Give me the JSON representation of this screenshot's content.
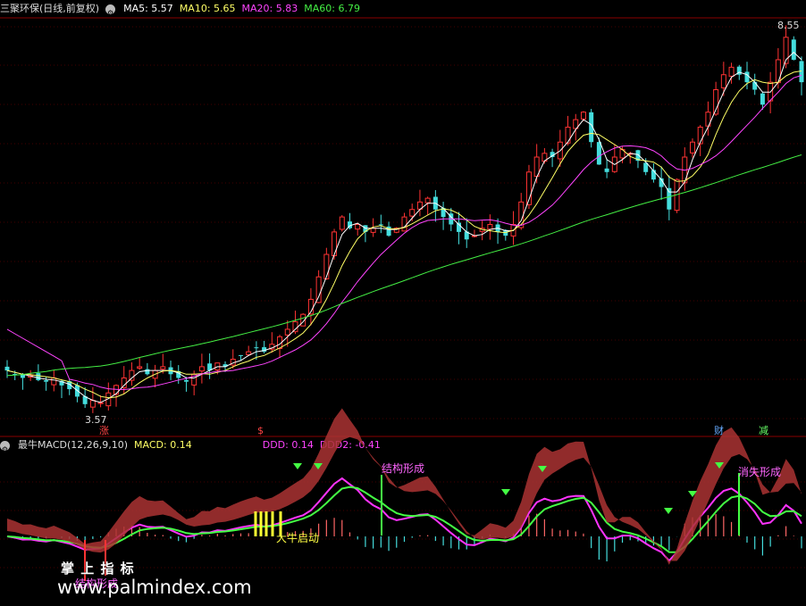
{
  "top": {
    "title": "三聚环保(日线,前复权)",
    "ma": [
      {
        "label": "MA5: 5.57",
        "color": "#ffffff"
      },
      {
        "label": "MA10: 5.65",
        "color": "#ffff66"
      },
      {
        "label": "MA20: 5.83",
        "color": "#ff44ff"
      },
      {
        "label": "MA60: 6.79",
        "color": "#44ee44"
      }
    ],
    "high_label": "8.55",
    "low_label": "3.57",
    "markers": [
      {
        "text": "涨",
        "color": "#ff4444"
      },
      {
        "text": "$",
        "color": "#ff4444"
      },
      {
        "text": "财",
        "color": "#66aaff"
      },
      {
        "text": "减",
        "color": "#66ff66"
      }
    ]
  },
  "bottom": {
    "title": "最牛MACD(12,26,9,10)",
    "indicators": [
      {
        "label": "MACD: 0.14",
        "color": "#ffff66"
      },
      {
        "label": "DDD: 0.14",
        "color": "#ff44ff"
      },
      {
        "label": "DDD2: -0.41",
        "color": "#ff44ff"
      }
    ],
    "annotations": [
      {
        "text": "结构形成",
        "color": "#ff66ff"
      },
      {
        "text": "消失形成",
        "color": "#ff66ff"
      },
      {
        "text": "大牛启动",
        "color": "#ffff44"
      },
      {
        "text": "结构形成",
        "color": "#ff66ff"
      }
    ]
  },
  "watermark": {
    "cn": "掌 上 指 标",
    "url": "www.palmindex.com"
  },
  "colors": {
    "up": "#ff3333",
    "down": "#44dddd",
    "ma5": "#ffffff",
    "ma10": "#ffff66",
    "ma20": "#ff44ff",
    "ma60": "#44ee44",
    "grid": "#8a0000"
  },
  "chart_data": [
    {
      "type": "candlestick",
      "title": "三聚环保(日线,前复权)",
      "ylim": [
        3.3,
        8.7
      ],
      "series": [
        {
          "name": "MA5",
          "values": []
        },
        {
          "name": "MA10",
          "values": []
        },
        {
          "name": "MA20",
          "values": []
        },
        {
          "name": "MA60",
          "values": []
        }
      ],
      "close": [
        4.05,
        4.0,
        3.95,
        3.98,
        3.92,
        3.9,
        3.95,
        3.85,
        3.8,
        3.7,
        3.6,
        3.65,
        3.62,
        3.75,
        3.85,
        3.95,
        4.05,
        4.1,
        4.0,
        4.05,
        4.1,
        4.0,
        3.95,
        3.9,
        4.0,
        4.1,
        4.05,
        4.15,
        4.1,
        4.2,
        4.25,
        4.3,
        4.35,
        4.3,
        4.4,
        4.5,
        4.6,
        4.7,
        4.8,
        5.0,
        5.3,
        5.6,
        5.9,
        6.1,
        5.95,
        6.0,
        5.9,
        5.95,
        6.0,
        5.85,
        5.95,
        6.1,
        6.2,
        6.3,
        6.35,
        6.2,
        6.1,
        6.0,
        5.9,
        5.8,
        5.85,
        5.95,
        6.0,
        5.9,
        5.85,
        6.0,
        6.3,
        6.7,
        6.9,
        6.95,
        6.9,
        7.1,
        7.3,
        7.4,
        7.5,
        7.1,
        6.8,
        6.7,
        6.9,
        7.0,
        6.95,
        6.85,
        6.7,
        6.6,
        6.5,
        6.2,
        6.6,
        6.9,
        7.1,
        7.3,
        7.5,
        7.8,
        8.0,
        8.1,
        8.0,
        7.9,
        7.8,
        7.6,
        7.9,
        8.2,
        8.5,
        8.2,
        7.9
      ]
    },
    {
      "type": "line",
      "title": "最牛MACD(12,26,9,10)",
      "series": [
        {
          "name": "MACD",
          "values": []
        },
        {
          "name": "DDD",
          "values": []
        },
        {
          "name": "DDD2",
          "values": []
        }
      ]
    }
  ]
}
